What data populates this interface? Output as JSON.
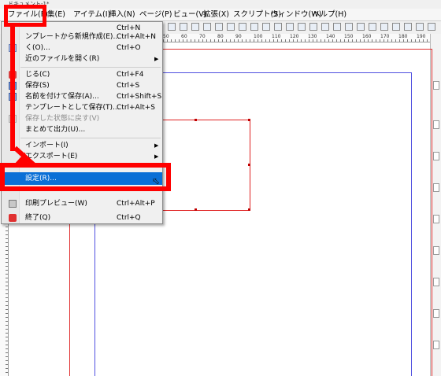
{
  "window": {
    "title": "ドキュメント-1*"
  },
  "menubar": {
    "items": [
      {
        "label": "ファイル(F)"
      },
      {
        "label": "集(E)"
      },
      {
        "label": "アイテム(I)"
      },
      {
        "label": "挿入(N)"
      },
      {
        "label": "ページ(P)"
      },
      {
        "label": "ビュー(V)"
      },
      {
        "label": "拡張(X)"
      },
      {
        "label": "スクリプト(S)"
      },
      {
        "label": "ウィンドウ(W)"
      },
      {
        "label": "ヘルプ(H)"
      }
    ]
  },
  "ruler": {
    "labels": [
      "50",
      "60",
      "70",
      "80",
      "90",
      "100",
      "110",
      "120",
      "130",
      "140",
      "150",
      "160",
      "170",
      "180",
      "190"
    ]
  },
  "file_menu": {
    "items": [
      {
        "label": "",
        "shortcut": "Ctrl+N"
      },
      {
        "label": "ンプレートから新規作成(E)...",
        "shortcut": "Ctrl+Alt+N"
      },
      {
        "label": "く(O)...",
        "shortcut": "Ctrl+O"
      },
      {
        "label": "近のファイルを開く(R)"
      },
      {
        "label": "じる(C)",
        "shortcut": "Ctrl+F4"
      },
      {
        "label": "保存(S)",
        "shortcut": "Ctrl+S"
      },
      {
        "label": "名前を付けて保存(A)...",
        "shortcut": "Ctrl+Shift+S"
      },
      {
        "label": "テンプレートとして保存(T)...",
        "shortcut": "Ctrl+Alt+S"
      },
      {
        "label": "保存した状態に戻す(V)"
      },
      {
        "label": "まとめて出力(U)..."
      },
      {
        "label": "インポート(I)"
      },
      {
        "label": "エクスポート(E)"
      },
      {
        "label": "設定(R)..."
      },
      {
        "label": "印刷プレビュー(W)",
        "shortcut": "Ctrl+Alt+P"
      },
      {
        "label": "終了(Q)",
        "shortcut": "Ctrl+Q"
      }
    ]
  },
  "colors": {
    "highlight": "#ff0000",
    "selection": "#0a6fd6",
    "page_border": "#e03030",
    "margin_guide": "#5050e0"
  }
}
